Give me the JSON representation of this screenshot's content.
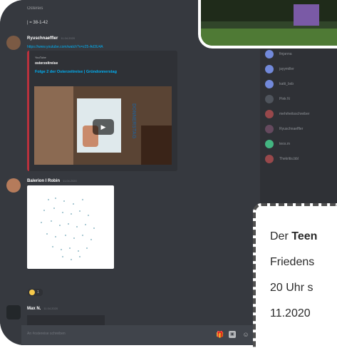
{
  "chat": {
    "header_title": "Ostereis",
    "top_line": "| = 38-1-42",
    "input_placeholder": "An #ostereise schreiben"
  },
  "messages": [
    {
      "author": "Ryuschnaeffler",
      "timestamp": "11.04.2020",
      "link": "https://www.youtube.com/watch?v=z25-Ad3U4A",
      "embed": {
        "provider": "YouTube",
        "author": "osterzeitreise",
        "title": "Folge 2 der Osterzeitreise | Gründonnerstag",
        "thumb_text": "DONNERSTAG"
      }
    },
    {
      "author": "Balerion I Robin",
      "timestamp": "11.04.2020",
      "reaction_count": "1"
    },
    {
      "author": "Max N.",
      "timestamp": "11.04.2020"
    }
  ],
  "members": [
    {
      "name": "finjanna"
    },
    {
      "name": "jayymiller"
    },
    {
      "name": "katti_bxb"
    },
    {
      "name": "Pink N"
    },
    {
      "name": "mehrheitsschreiber"
    },
    {
      "name": "Ryuschnaeffler"
    },
    {
      "name": "teos.m"
    },
    {
      "name": "Thekritis.bbl"
    }
  ],
  "overlay": {
    "line1_pre": "Der ",
    "line1_bold": "Teen",
    "line2": "Friedens",
    "line3": "20 Uhr s",
    "line4": "11.2020"
  },
  "colors": {
    "chat_bg": "#36393f",
    "sidebar_bg": "#2f3136",
    "link": "#00b0f4",
    "embed_bar": "#b9313d",
    "blurple": "#7289da",
    "online_green": "#43b581",
    "muted_red": "#e0585a"
  },
  "icons": [
    "gift-icon",
    "gif-icon",
    "emoji-icon",
    "play-icon"
  ]
}
